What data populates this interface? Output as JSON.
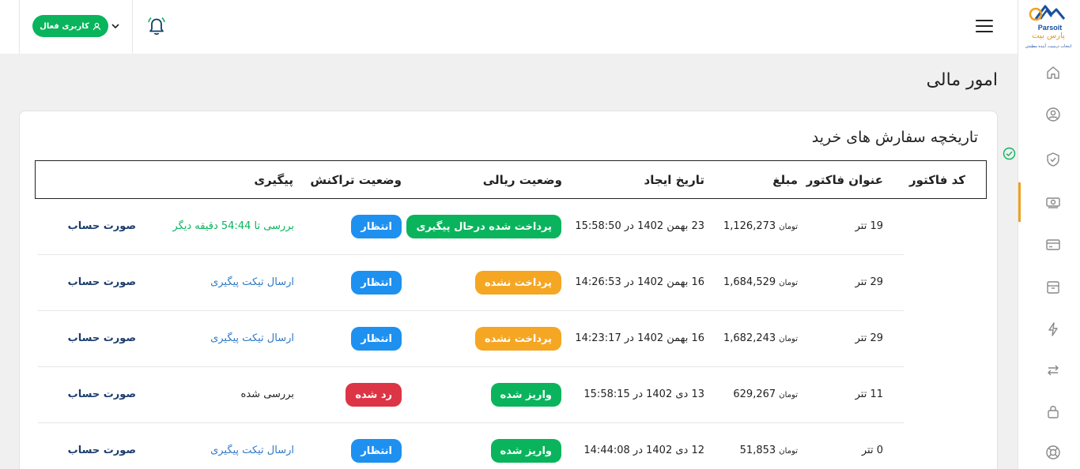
{
  "header": {
    "user_button_label": "کاربری فعال"
  },
  "logo": {
    "brand_en": "Parsoit",
    "brand_fa": "پارس بیت",
    "tagline": "انتخاب درست، آینده مطمئن"
  },
  "page": {
    "title": "امور مالی"
  },
  "card": {
    "title": "تاریخچه سفارش های خرید"
  },
  "table": {
    "headers": {
      "invoice_code": "کد فاکتور",
      "invoice_title": "عنوان فاکتور",
      "amount": "مبلغ",
      "created": "تاریخ ایجاد",
      "rial_status": "وضعیت ریالی",
      "tx_status": "وضعیت تراکنش",
      "tracking": "پیگیری"
    },
    "rows": [
      {
        "title": "19 تتر",
        "amount": "1,126,273",
        "unit": "تومان",
        "created": "23 بهمن 1402 در 15:58:50",
        "rial_status": "پرداخت شده درحال پیگیری",
        "rial_color": "#0ab45c",
        "tx_status": "انتظار",
        "tx_color": "#1e90f0",
        "tracking": "بررسی تا 54:44 دقیقه دیگر",
        "tracking_color": "#0ab45c",
        "invoice": "صورت حساب"
      },
      {
        "title": "29 تتر",
        "amount": "1,684,529",
        "unit": "تومان",
        "created": "16 بهمن 1402 در 14:26:53",
        "rial_status": "پرداخت نشده",
        "rial_color": "#f5a623",
        "tx_status": "انتظار",
        "tx_color": "#1e90f0",
        "tracking": "ارسال تیکت پیگیری",
        "tracking_color": "#2f7ac6",
        "invoice": "صورت حساب"
      },
      {
        "title": "29 تتر",
        "amount": "1,682,243",
        "unit": "تومان",
        "created": "16 بهمن 1402 در 14:23:17",
        "rial_status": "پرداخت نشده",
        "rial_color": "#f5a623",
        "tx_status": "انتظار",
        "tx_color": "#1e90f0",
        "tracking": "ارسال تیکت پیگیری",
        "tracking_color": "#2f7ac6",
        "invoice": "صورت حساب"
      },
      {
        "title": "11 تتر",
        "amount": "629,267",
        "unit": "تومان",
        "created": "13 دی 1402 در 15:58:15",
        "rial_status": "واریز شده",
        "rial_color": "#0ab45c",
        "tx_status": "رد شده",
        "tx_color": "#dc3545",
        "tracking": "بررسی شده",
        "tracking_color": "#222222",
        "invoice": "صورت حساب"
      },
      {
        "title": "0 تتر",
        "amount": "51,853",
        "unit": "تومان",
        "created": "12 دی 1402 در 14:44:08",
        "rial_status": "واریز شده",
        "rial_color": "#0ab45c",
        "tx_status": "انتظار",
        "tx_color": "#1e90f0",
        "tracking": "ارسال تیکت پیگیری",
        "tracking_color": "#2f7ac6",
        "invoice": "صورت حساب"
      }
    ]
  },
  "sidebar": {
    "icons": [
      "home-icon",
      "user-circle-icon",
      "shield-check-icon",
      "money-icon",
      "credit-card-icon",
      "archive-icon",
      "lightning-icon",
      "exchange-icon",
      "lock-icon",
      "support-icon"
    ],
    "accent_color": "#f0a020"
  },
  "colors": {
    "brand_green": "#0ab45c",
    "link_blue": "#2f7ac6"
  }
}
